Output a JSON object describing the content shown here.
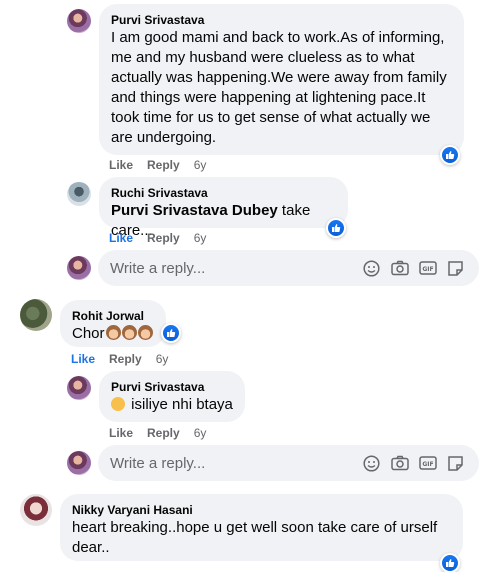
{
  "comments": [
    {
      "author": "Purvi Srivastava",
      "lines": [
        "I am good mami and back to work.As of informing,",
        "me and my husband were clueless as to what",
        "actually was happening.We were away from family",
        "and things were happening at lightening pace.It",
        "took time for us to get sense of what actually we",
        "are undergoing."
      ],
      "like": "Like",
      "reply": "Reply",
      "time": "6y"
    },
    {
      "author": "Ruchi Srivastava",
      "mention": "Purvi Srivastava Dubey",
      "text": " take care...",
      "like": "Like",
      "reply": "Reply",
      "time": "6y"
    },
    {
      "author": "Rohit Jorwal",
      "text": "Chor",
      "like": "Like",
      "reply": "Reply",
      "time": "6y"
    },
    {
      "author": "Purvi Srivastava",
      "text": "isiliye nhi btaya",
      "like": "Like",
      "reply": "Reply",
      "time": "6y"
    },
    {
      "author": "Nikky Varyani Hasani",
      "lines": [
        "heart breaking..hope u get well soon take care of urself",
        "dear.."
      ]
    }
  ],
  "reply_box": {
    "placeholder": "Write a reply..."
  },
  "icons": [
    "emoji-icon",
    "camera-icon",
    "gif-icon",
    "sticker-icon",
    "like-reaction-icon"
  ],
  "colors": {
    "bubble": "#f0f2f5",
    "accent": "#1b74e4",
    "muted": "#65676b"
  }
}
